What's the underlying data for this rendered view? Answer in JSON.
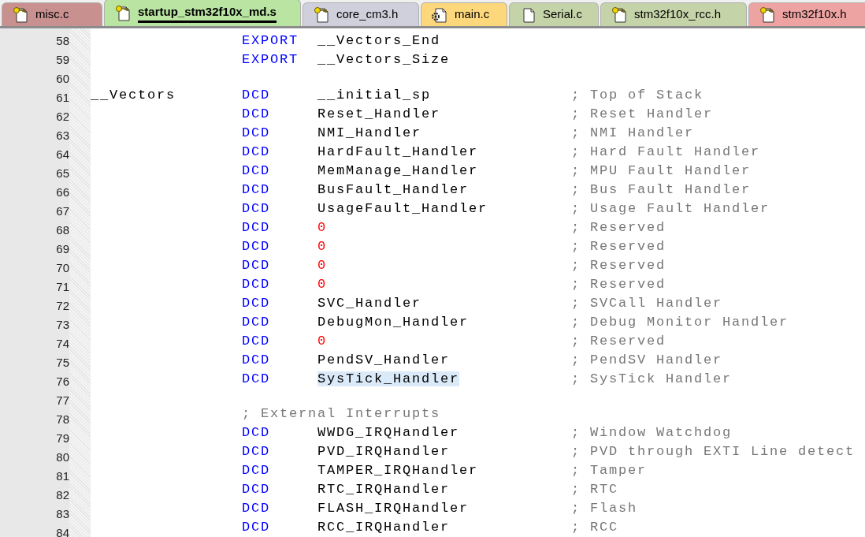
{
  "tabs": [
    {
      "label": "misc.c",
      "selected": false,
      "color": "#c99090",
      "kind": "key"
    },
    {
      "label": "startup_stm32f10x_md.s",
      "selected": true,
      "color": "#b9e4a2",
      "kind": "key"
    },
    {
      "label": "core_cm3.h",
      "selected": false,
      "color": "#cfd0dc",
      "kind": "key"
    },
    {
      "label": "main.c",
      "selected": false,
      "color": "#fcd77c",
      "kind": "gear"
    },
    {
      "label": "Serial.c",
      "selected": false,
      "color": "#c5d3a8",
      "kind": "plain"
    },
    {
      "label": "stm32f10x_rcc.h",
      "selected": false,
      "color": "#c5d3a8",
      "kind": "key"
    },
    {
      "label": "stm32f10x.h",
      "selected": false,
      "color": "#eea3a3",
      "kind": "key"
    }
  ],
  "lines": [
    {
      "number": "58",
      "kind": "code",
      "opcode": "EXPORT",
      "operand": "__Vectors_End",
      "highlighted": false
    },
    {
      "number": "59",
      "kind": "code",
      "opcode": "EXPORT",
      "operand": "__Vectors_Size",
      "highlighted": false
    },
    {
      "number": "60",
      "kind": "blank"
    },
    {
      "number": "61",
      "kind": "code",
      "label": "__Vectors",
      "opcode": "DCD",
      "operand": "__initial_sp",
      "comment": "; Top of Stack",
      "highlighted": false
    },
    {
      "number": "62",
      "kind": "code",
      "opcode": "DCD",
      "operand": "Reset_Handler",
      "comment": "; Reset Handler",
      "highlighted": false
    },
    {
      "number": "63",
      "kind": "code",
      "opcode": "DCD",
      "operand": "NMI_Handler",
      "comment": "; NMI Handler",
      "highlighted": false
    },
    {
      "number": "64",
      "kind": "code",
      "opcode": "DCD",
      "operand": "HardFault_Handler",
      "comment": "; Hard Fault Handler",
      "highlighted": false
    },
    {
      "number": "65",
      "kind": "code",
      "opcode": "DCD",
      "operand": "MemManage_Handler",
      "comment": "; MPU Fault Handler",
      "highlighted": false
    },
    {
      "number": "66",
      "kind": "code",
      "opcode": "DCD",
      "operand": "BusFault_Handler",
      "comment": "; Bus Fault Handler",
      "highlighted": false
    },
    {
      "number": "67",
      "kind": "code",
      "opcode": "DCD",
      "operand": "UsageFault_Handler",
      "comment": "; Usage Fault Handler",
      "highlighted": false
    },
    {
      "number": "68",
      "kind": "code_number",
      "opcode": "DCD",
      "operand": "0",
      "comment": "; Reserved",
      "highlighted": false
    },
    {
      "number": "69",
      "kind": "code_number",
      "opcode": "DCD",
      "operand": "0",
      "comment": "; Reserved",
      "highlighted": false
    },
    {
      "number": "70",
      "kind": "code_number",
      "opcode": "DCD",
      "operand": "0",
      "comment": "; Reserved",
      "highlighted": false
    },
    {
      "number": "71",
      "kind": "code_number",
      "opcode": "DCD",
      "operand": "0",
      "comment": "; Reserved",
      "highlighted": false
    },
    {
      "number": "72",
      "kind": "code",
      "opcode": "DCD",
      "operand": "SVC_Handler",
      "comment": "; SVCall Handler",
      "highlighted": false
    },
    {
      "number": "73",
      "kind": "code",
      "opcode": "DCD",
      "operand": "DebugMon_Handler",
      "comment": "; Debug Monitor Handler",
      "highlighted": false
    },
    {
      "number": "74",
      "kind": "code_number",
      "opcode": "DCD",
      "operand": "0",
      "comment": "; Reserved",
      "highlighted": false
    },
    {
      "number": "75",
      "kind": "code",
      "opcode": "DCD",
      "operand": "PendSV_Handler",
      "comment": "; PendSV Handler",
      "highlighted": false
    },
    {
      "number": "76",
      "kind": "code",
      "opcode": "DCD",
      "operand": "SysTick_Handler",
      "comment": "; SysTick Handler",
      "highlighted": true
    },
    {
      "number": "77",
      "kind": "blank"
    },
    {
      "number": "78",
      "kind": "comment",
      "comment": "; External Interrupts"
    },
    {
      "number": "79",
      "kind": "code",
      "opcode": "DCD",
      "operand": "WWDG_IRQHandler",
      "comment": "; Window Watchdog",
      "highlighted": false
    },
    {
      "number": "80",
      "kind": "code",
      "opcode": "DCD",
      "operand": "PVD_IRQHandler",
      "comment": "; PVD through EXTI Line detect",
      "highlighted": false
    },
    {
      "number": "81",
      "kind": "code",
      "opcode": "DCD",
      "operand": "TAMPER_IRQHandler",
      "comment": "; Tamper",
      "highlighted": false
    },
    {
      "number": "82",
      "kind": "code",
      "opcode": "DCD",
      "operand": "RTC_IRQHandler",
      "comment": "; RTC",
      "highlighted": false
    },
    {
      "number": "83",
      "kind": "code",
      "opcode": "DCD",
      "operand": "FLASH_IRQHandler",
      "comment": "; Flash",
      "highlighted": false
    },
    {
      "number": "84",
      "kind": "code",
      "opcode": "DCD",
      "operand": "RCC_IRQHandler",
      "comment": "; RCC",
      "highlighted": false
    }
  ]
}
